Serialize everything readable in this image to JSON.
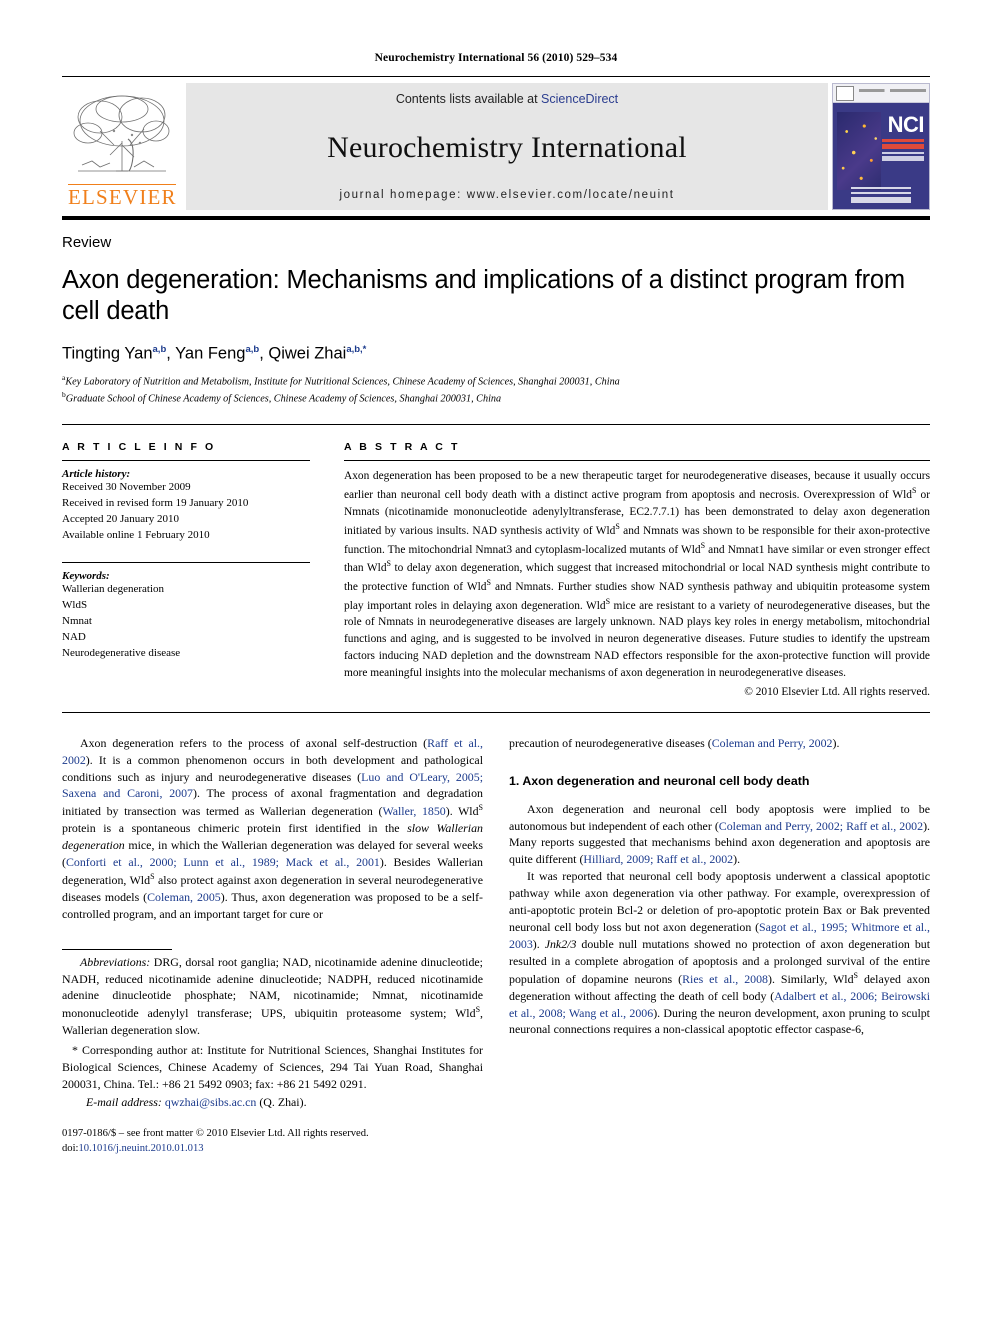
{
  "running_head": "Neurochemistry International 56 (2010) 529–534",
  "masthead": {
    "contents_prefix": "Contents lists available at ",
    "sciencedirect": "ScienceDirect",
    "journal_title": "Neurochemistry International",
    "homepage": "journal homepage: www.elsevier.com/locate/neuint",
    "publisher": "ELSEVIER",
    "cover_acronym": "NCI",
    "colors": {
      "link": "#2b3d8f",
      "elsevier_orange": "#f07f1a",
      "masthead_bg": "#e6e6e6",
      "cover_bg": "#3a3a86"
    }
  },
  "article": {
    "type": "Review",
    "title": "Axon degeneration: Mechanisms and implications of a distinct program from cell death",
    "authors": [
      {
        "name": "Tingting Yan",
        "marks": "a,b",
        "sep": ", "
      },
      {
        "name": "Yan Feng",
        "marks": "a,b",
        "sep": ", "
      },
      {
        "name": "Qiwei Zhai",
        "marks": "a,b,*",
        "sep": ""
      }
    ],
    "affiliations": [
      {
        "mark": "a",
        "text": "Key Laboratory of Nutrition and Metabolism, Institute for Nutritional Sciences, Chinese Academy of Sciences, Shanghai 200031, China"
      },
      {
        "mark": "b",
        "text": "Graduate School of Chinese Academy of Sciences, Chinese Academy of Sciences, Shanghai 200031, China"
      }
    ]
  },
  "article_info": {
    "heading": "A R T I C L E   I N F O",
    "history_label": "Article history:",
    "history": [
      "Received 30 November 2009",
      "Received in revised form 19 January 2010",
      "Accepted 20 January 2010",
      "Available online 1 February 2010"
    ],
    "keywords_label": "Keywords:",
    "keywords": [
      "Wallerian degeneration",
      "WldS",
      "Nmnat",
      "NAD",
      "Neurodegenerative disease"
    ]
  },
  "abstract": {
    "heading": "A B S T R A C T",
    "paragraphs": [
      "Axon degeneration has been proposed to be a new therapeutic target for neurodegenerative diseases, because it usually occurs earlier than neuronal cell body death with a distinct active program from apoptosis and necrosis. Overexpression of Wld",
      " or Nmnats (nicotinamide mononucleotide adenylyltransferase, EC2.7.7.1) has been demonstrated to delay axon degeneration initiated by various insults. NAD synthesis activity of Wld",
      " and Nmnats was shown to be responsible for their axon-protective function. The mitochondrial Nmnat3 and cytoplasm-localized mutants of Wld",
      " and Nmnat1 have similar or even stronger effect than Wld",
      " to delay axon degeneration, which suggest that increased mitochondrial or local NAD synthesis might contribute to the protective function of Wld",
      " and Nmnats. Further studies show NAD synthesis pathway and ubiquitin proteasome system play important roles in delaying axon degeneration. Wld",
      " mice are resistant to a variety of neurodegenerative diseases, but the role of Nmnats in neurodegenerative diseases are largely unknown. NAD plays key roles in energy metabolism, mitochondrial functions and aging, and is suggested to be involved in neuron degenerative diseases. Future studies to identify the upstream factors inducing NAD depletion and the downstream NAD effectors responsible for the axon-protective function will provide more meaningful insights into the molecular mechanisms of axon degeneration in neurodegenerative diseases."
    ],
    "superscript": "S",
    "copyright": "© 2010 Elsevier Ltd. All rights reserved."
  },
  "body": {
    "left_column": {
      "p1_part1": "Axon degeneration refers to the process of axonal self-destruction (",
      "p1_ref1": "Raff et al., 2002",
      "p1_part2": "). It is a common phenomenon occurs in both development and pathological conditions such as injury and neurodegenerative diseases (",
      "p1_ref2": "Luo and O'Leary, 2005; Saxena and Caroni, 2007",
      "p1_part3": "). The process of axonal fragmentation and degradation initiated by transection was termed as Wallerian degeneration (",
      "p1_ref3": "Waller, 1850",
      "p1_part4": "). Wld",
      "p1_part5": " protein is a spontaneous chimeric protein first identified in the ",
      "p1_italic": "slow Wallerian degeneration",
      "p1_part6": " mice, in which the Wallerian degeneration was delayed for several weeks (",
      "p1_ref4": "Conforti et al., 2000; Lunn et al., 1989; Mack et al., 2001",
      "p1_part7": "). Besides Wallerian degeneration, Wld",
      "p1_part8": " also protect against axon degeneration in several neurodegenerative diseases models (",
      "p1_ref5": "Coleman, 2005",
      "p1_part9": "). Thus, axon degeneration was proposed to be a self-controlled program, and an important target for cure or"
    },
    "right_column": {
      "p1_part1": "precaution of neurodegenerative diseases (",
      "p1_ref1": "Coleman and Perry, 2002",
      "p1_part2": ").",
      "section_heading": "1. Axon degeneration and neuronal cell body death",
      "p2_part1": "Axon degeneration and neuronal cell body apoptosis were implied to be autonomous but independent of each other (",
      "p2_ref1": "Coleman and Perry, 2002; Raff et al., 2002",
      "p2_part2": "). Many reports suggested that mechanisms behind axon degeneration and apoptosis are quite different (",
      "p2_ref2": "Hilliard, 2009; Raff et al., 2002",
      "p2_part3": ").",
      "p3_part1": "It was reported that neuronal cell body apoptosis underwent a classical apoptotic pathway while axon degeneration via other pathway. For example, overexpression of anti-apoptotic protein Bcl-2 or deletion of pro-apoptotic protein Bax or Bak prevented neuronal cell body loss but not axon degeneration (",
      "p3_ref1": "Sagot et al., 1995; Whitmore et al., 2003",
      "p3_part2": "). ",
      "p3_italic": "Jnk2/3",
      "p3_part3": " double null mutations showed no protection of axon degeneration but resulted in a complete abrogation of apoptosis and a prolonged survival of the entire population of dopamine neurons (",
      "p3_ref2": "Ries et al., 2008",
      "p3_part4": "). Similarly, Wld",
      "p3_part5": " delayed axon degeneration without affecting the death of cell body (",
      "p3_ref3": "Adalbert et al., 2006; Beirowski et al., 2008; Wang et al., 2006",
      "p3_part6": "). During the neuron development, axon pruning to sculpt neuronal connections requires a non-classical apoptotic effector caspase-6,"
    }
  },
  "footnotes": {
    "abbrev_label": "Abbreviations:",
    "abbrev_text_1": " DRG, dorsal root ganglia; NAD, nicotinamide adenine dinucleotide; NADH, reduced nicotinamide adenine dinucleotide; NADPH, reduced nicotinamide adenine dinucleotide phosphate; NAM, nicotinamide; Nmnat, nicotinamide mononucleotide adenylyl transferase; UPS, ubiquitin proteasome system; Wld",
    "abbrev_sup": "S",
    "abbrev_text_2": ", Wallerian degeneration slow.",
    "corresponding": "* Corresponding author at: Institute for Nutritional Sciences, Shanghai Institutes for Biological Sciences, Chinese Academy of Sciences, 294 Tai Yuan Road, Shanghai 200031, China. Tel.: +86 21 5492 0903; fax: +86 21 5492 0291.",
    "email_label": "E-mail address:",
    "email_value": "qwzhai@sibs.ac.cn",
    "email_suffix": " (Q. Zhai).",
    "issn_line": "0197-0186/$ – see front matter © 2010 Elsevier Ltd. All rights reserved.",
    "doi_label": "doi:",
    "doi_value": "10.1016/j.neuint.2010.01.013"
  }
}
